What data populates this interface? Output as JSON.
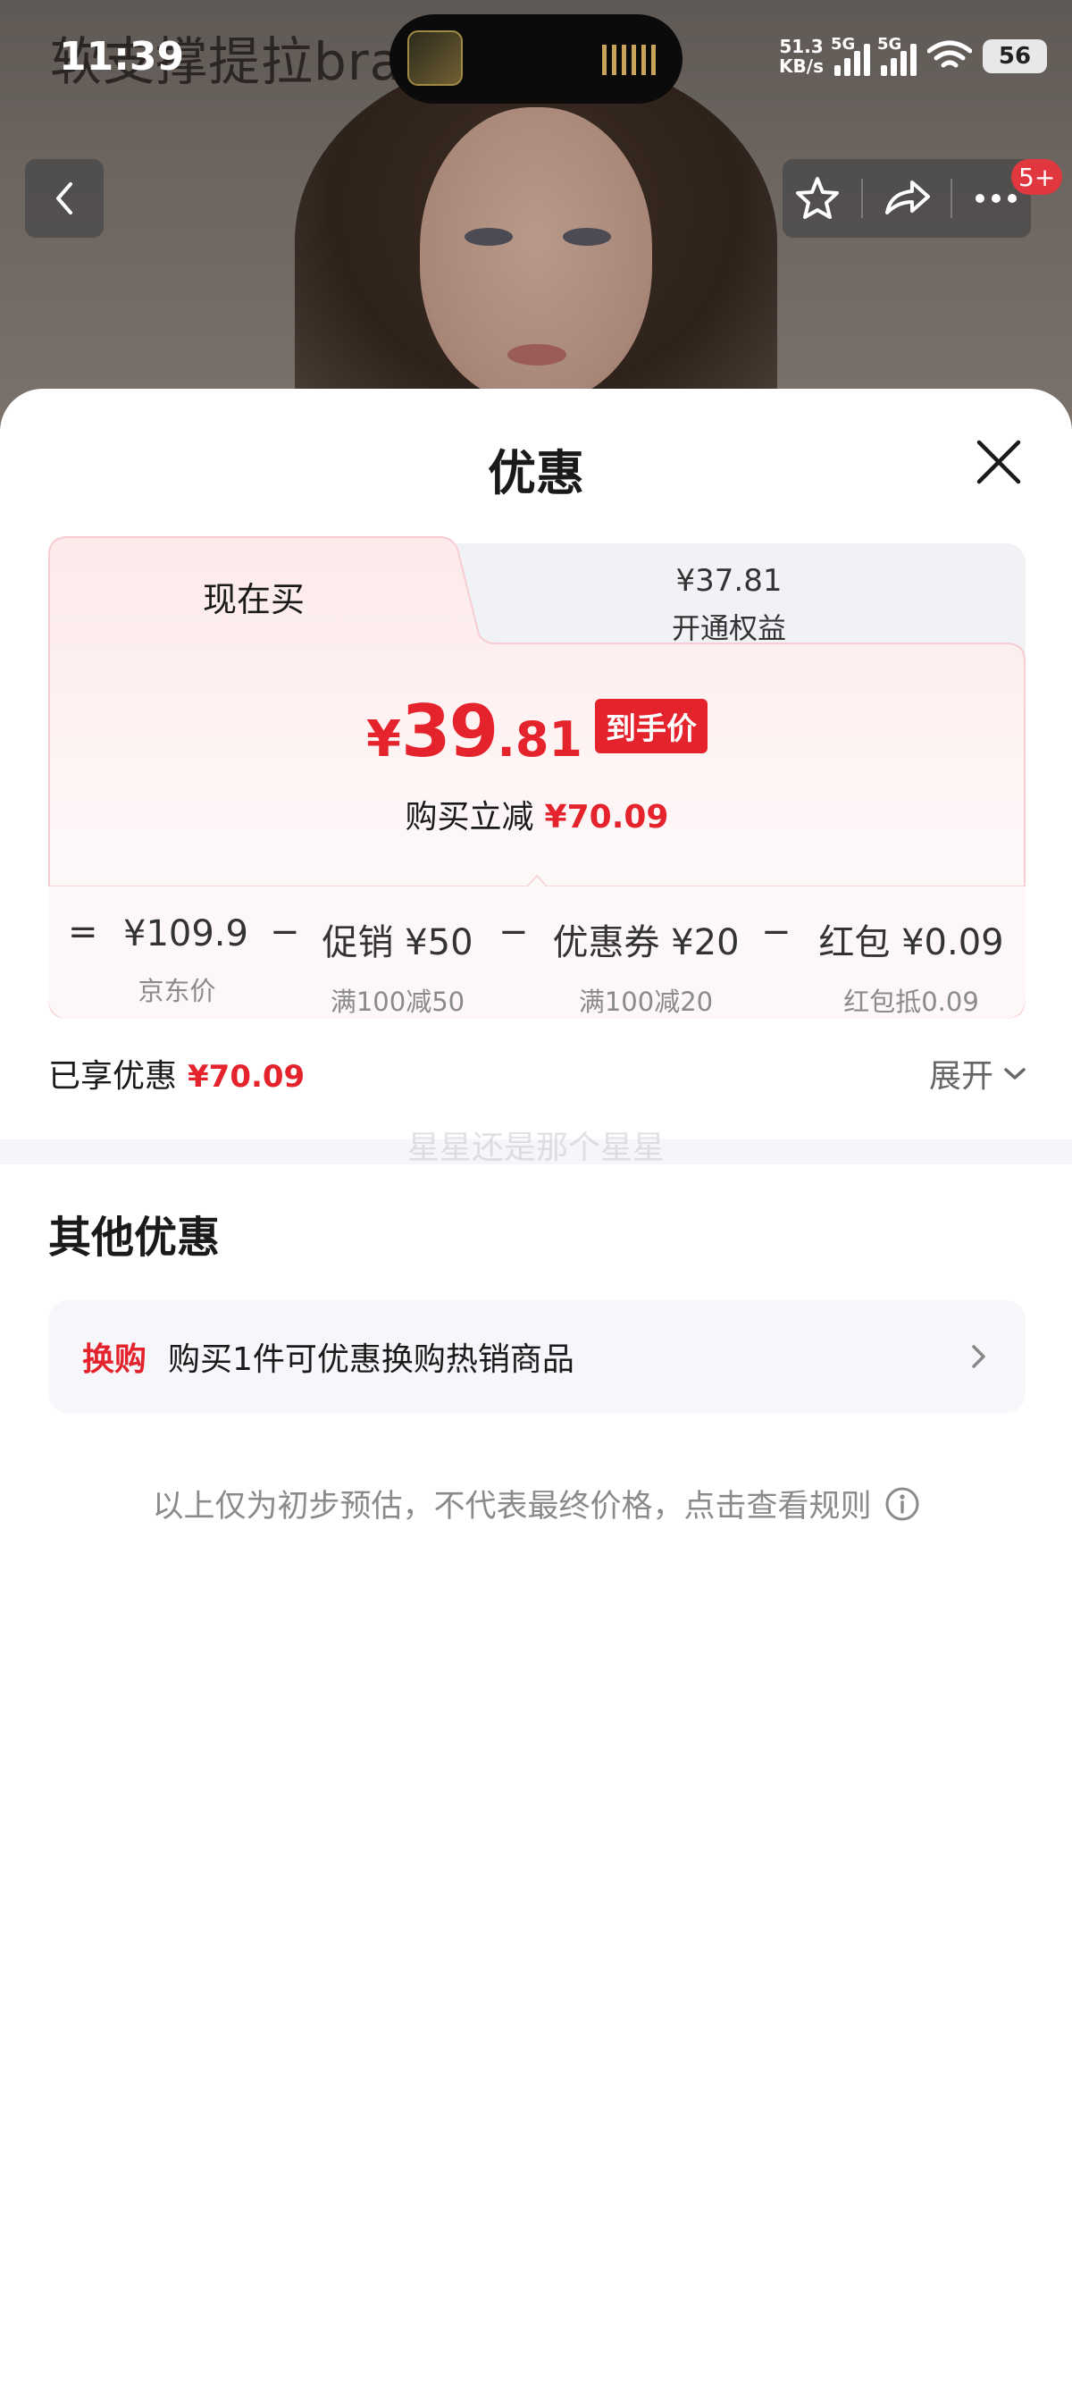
{
  "background": {
    "title": "软支撑提拉bra"
  },
  "status_bar": {
    "time": "11:39",
    "net_speed_value": "51.3",
    "net_speed_unit": "KB/s",
    "signal_1": "5G",
    "signal_2": "5G",
    "battery": "56"
  },
  "top_bar": {
    "badge_count": "5+"
  },
  "sheet": {
    "title": "优惠",
    "tabs": [
      {
        "label": "现在买"
      },
      {
        "price": "¥37.81",
        "label": "开通权益"
      }
    ],
    "final_price": {
      "currency": "¥",
      "integer": "39",
      "decimal": ".81",
      "badge": "到手价"
    },
    "savings": {
      "label": "购买立减",
      "amount": "¥70.09"
    },
    "breakdown": {
      "equals": "=",
      "items": [
        {
          "value": "¥109.9",
          "desc": "京东价"
        },
        {
          "value": "促销 ¥50",
          "desc": "满100减50"
        },
        {
          "value": "优惠券 ¥20",
          "desc": "满100减20"
        },
        {
          "value": "红包 ¥0.09",
          "desc": "红包抵0.09"
        }
      ],
      "minus": "−"
    },
    "enjoyed": {
      "label": "已享优惠",
      "amount": "¥70.09",
      "expand_label": "展开"
    },
    "watermark": "星星还是那个星星",
    "other": {
      "title": "其他优惠",
      "promo_tag": "换购",
      "promo_text": "购买1件可优惠换购热销商品"
    },
    "note": "以上仅为初步预估，不代表最终价格，点击查看规则"
  },
  "colors": {
    "accent_red": "#e4232d",
    "divider": "#f4f6f9"
  }
}
